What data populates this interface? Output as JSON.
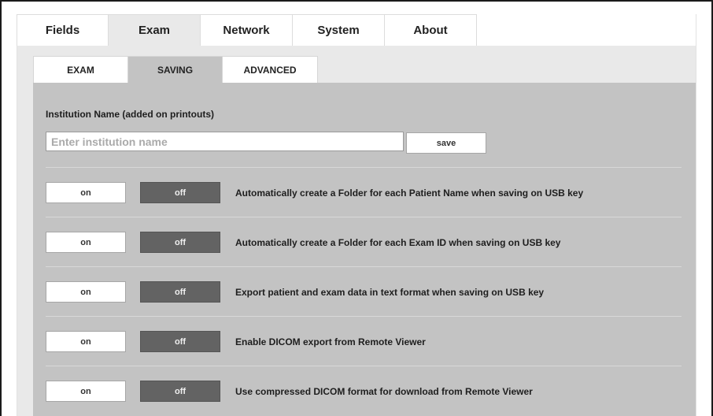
{
  "top_tabs": [
    "Fields",
    "Exam",
    "Network",
    "System",
    "About"
  ],
  "active_top_tab": "Exam",
  "sub_tabs": [
    "EXAM",
    "SAVING",
    "ADVANCED"
  ],
  "active_sub_tab": "SAVING",
  "institution": {
    "label": "Institution Name (added on printouts)",
    "placeholder": "Enter institution name",
    "value": "",
    "save_label": "save"
  },
  "options": [
    {
      "on_label": "on",
      "off_label": "off",
      "state": "off",
      "label": "Automatically create a Folder for each Patient Name when saving on USB key"
    },
    {
      "on_label": "on",
      "off_label": "off",
      "state": "off",
      "label": "Automatically create a Folder for each Exam ID when saving on USB key"
    },
    {
      "on_label": "on",
      "off_label": "off",
      "state": "off",
      "label": "Export patient and exam data in text format when saving on USB key"
    },
    {
      "on_label": "on",
      "off_label": "off",
      "state": "off",
      "label": "Enable DICOM export from Remote Viewer"
    },
    {
      "on_label": "on",
      "off_label": "off",
      "state": "off",
      "label": "Use compressed DICOM format for download from Remote Viewer"
    }
  ],
  "colors": {
    "panel_bg": "#e9e9e9",
    "content_bg": "#c3c3c3",
    "off_active": "#636363"
  }
}
